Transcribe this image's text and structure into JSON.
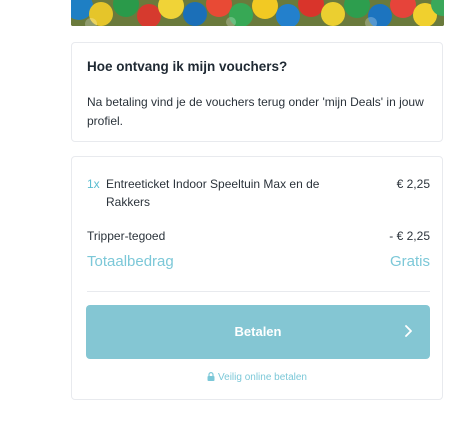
{
  "info": {
    "title": "Hoe ontvang ik mijn vouchers?",
    "body": "Na betaling vind je de vouchers terug onder 'mijn Deals' in jouw profiel."
  },
  "order": {
    "item": {
      "qty": "1x",
      "name": "Entreeticket Indoor Speeltuin Max en de Rakkers",
      "price": "€ 2,25"
    },
    "credit": {
      "label": "Tripper-tegoed",
      "value": "- € 2,25"
    },
    "total": {
      "label": "Totaalbedrag",
      "value": "Gratis"
    }
  },
  "pay": {
    "label": "Betalen",
    "icon": "chevron-right-icon"
  },
  "secure": {
    "label": "Veilig online betalen",
    "icon": "lock-icon"
  },
  "colors": {
    "accent": "#7cc8d8",
    "button": "#84c6d3"
  }
}
